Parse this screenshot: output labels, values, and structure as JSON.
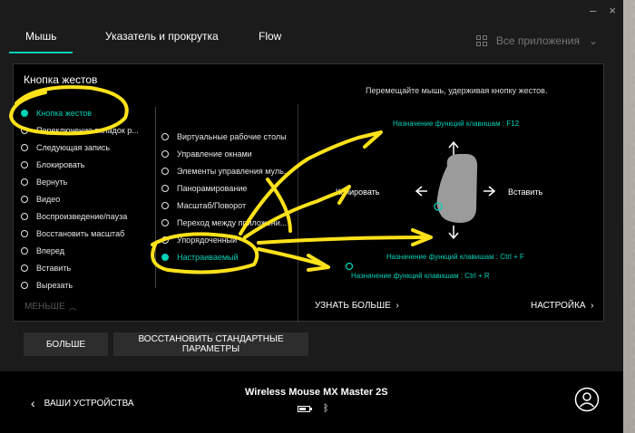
{
  "tabs": [
    {
      "label": "Мышь",
      "active": true
    },
    {
      "label": "Указатель и прокрутка",
      "active": false
    },
    {
      "label": "Flow",
      "active": false
    }
  ],
  "apps_label": "Все приложения",
  "window": {
    "minimize": "–",
    "close": "×"
  },
  "panel": {
    "title": "Кнопка жестов",
    "hint": "Перемещайте мышь, удерживая кнопку жестов."
  },
  "left_list": [
    {
      "label": "Кнопка жестов",
      "active": true
    },
    {
      "label": "Переключение вкладок р...",
      "active": false
    },
    {
      "label": "Следующая запись",
      "active": false
    },
    {
      "label": "Блокировать",
      "active": false
    },
    {
      "label": "Вернуть",
      "active": false
    },
    {
      "label": "Видео",
      "active": false
    },
    {
      "label": "Воспроизведение/пауза",
      "active": false
    },
    {
      "label": "Восстановить масштаб",
      "active": false
    },
    {
      "label": "Вперед",
      "active": false
    },
    {
      "label": "Вставить",
      "active": false
    },
    {
      "label": "Вырезать",
      "active": false
    }
  ],
  "right_list": [
    {
      "label": "Виртуальные рабочие столы",
      "active": false
    },
    {
      "label": "Управление окнами",
      "active": false
    },
    {
      "label": "Элементы управления муль...",
      "active": false
    },
    {
      "label": "Панорамирование",
      "active": false
    },
    {
      "label": "Масштаб/Поворот",
      "active": false
    },
    {
      "label": "Переход между приложени...",
      "active": false
    },
    {
      "label": "Упорядоченный",
      "active": false
    },
    {
      "label": "Настраиваемый",
      "active": true
    }
  ],
  "gestures": {
    "up": "Назначение функций клавишам : F12",
    "left": "Копировать",
    "right": "Вставить",
    "down": "Назначение функций клавишам : Ctrl + F",
    "click": "Назначение функций клавишам : Ctrl + R"
  },
  "less_label": "МЕНЬШЕ",
  "learn_more": "УЗНАТЬ БОЛЬШЕ",
  "setup": "НАСТРОЙКА",
  "buttons": {
    "more": "БОЛЬШЕ",
    "restore": "ВОССТАНОВИТЬ СТАНДАРТНЫЕ ПАРАМЕТРЫ"
  },
  "footer": {
    "back_label": "ВАШИ УСТРОЙСТВА",
    "device_name": "Wireless Mouse MX Master 2S",
    "battery_level": 0.6
  },
  "colors": {
    "accent": "#00d1b7",
    "annotation": "#ffe21a"
  }
}
